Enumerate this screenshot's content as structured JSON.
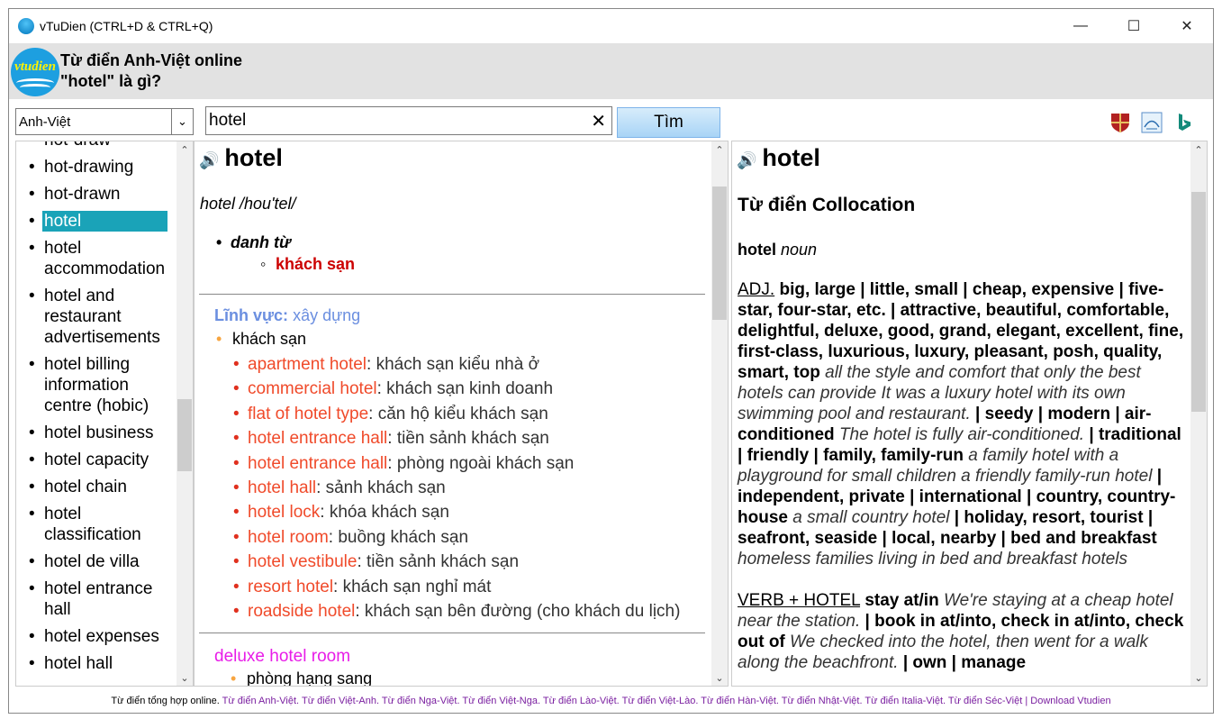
{
  "window": {
    "title": "vTuDien (CTRL+D & CTRL+Q)"
  },
  "header": {
    "logo_text": "vtudien",
    "line1": "Từ điển Anh-Việt online",
    "line2": "\"hotel\" là gì?"
  },
  "toolbar": {
    "lang": "Anh-Việt",
    "search_value": "hotel",
    "search_button": "Tìm"
  },
  "left_list": [
    "hot-draw",
    "hot-drawing",
    "hot-drawn",
    "hotel",
    "hotel accommodation",
    "hotel and restaurant advertisements",
    "hotel billing information centre (hobic)",
    "hotel business",
    "hotel capacity",
    "hotel chain",
    "hotel classification",
    "hotel de villa",
    "hotel entrance hall",
    "hotel expenses",
    "hotel hall"
  ],
  "mid": {
    "word": "hotel",
    "pron": "hotel /hou'tel/",
    "pos": "danh từ",
    "meaning": "khách sạn",
    "field_label": "Lĩnh vực:",
    "field_value": "xây dựng",
    "group": "khách sạn",
    "examples": [
      {
        "t": "apartment hotel",
        "m": ": khách sạn kiểu nhà ở"
      },
      {
        "t": "commercial hotel",
        "m": ": khách sạn kinh doanh"
      },
      {
        "t": "flat of hotel type",
        "m": ": căn hộ kiểu khách sạn"
      },
      {
        "t": "hotel entrance hall",
        "m": ": tiền sảnh khách sạn"
      },
      {
        "t": "hotel entrance hall",
        "m": ": phòng ngoài khách sạn"
      },
      {
        "t": "hotel hall",
        "m": ": sảnh khách sạn"
      },
      {
        "t": "hotel lock",
        "m": ": khóa khách sạn"
      },
      {
        "t": "hotel room",
        "m": ": buồng khách sạn"
      },
      {
        "t": "hotel vestibule",
        "m": ": tiền sảnh khách sạn"
      },
      {
        "t": "resort hotel",
        "m": ": khách sạn nghỉ mát"
      },
      {
        "t": "roadside hotel",
        "m": ": khách sạn bên đường (cho khách du lịch)"
      }
    ],
    "deluxe": "deluxe hotel room",
    "deluxe_meaning": "phòng hạng sang"
  },
  "right": {
    "word": "hotel",
    "coll": "Từ điển Collocation",
    "noun_word": "hotel",
    "noun": "noun",
    "adj_label": "ADJ.",
    "adj_bold1": "big, large | little, small | cheap, expensive | five-star, four-star, etc. | attractive, beautiful, comfortable, delightful, deluxe, good, grand, elegant, excellent, fine, first-class, luxurious, luxury, pleasant, posh, quality, smart, top",
    "adj_it1": "all the style and comfort that only the best hotels can provide It was a luxury hotel with its own swimming pool and restaurant.",
    "adj_bold2": "| seedy | modern | air-conditioned",
    "adj_it2": "The hotel is fully air-conditioned.",
    "adj_bold3": "| traditional | friendly | family, family-run",
    "adj_it3": "a family hotel with a playground for small children a friendly family-run hotel",
    "adj_bold4": "| independent, private | international | country, country-house",
    "adj_it4": "a small country hotel",
    "adj_bold5": "| holiday, resort, tourist | seafront, seaside | local, nearby | bed and breakfast",
    "adj_it5": "homeless families living in bed and breakfast hotels",
    "verb_label": "VERB + HOTEL",
    "verb_bold1": "stay at/in",
    "verb_it1": "We're staying at a cheap hotel near the station.",
    "verb_bold2": "| book in at/into, check in at/into, check out of",
    "verb_it2": "We checked into the hotel, then went for a walk along the beachfront.",
    "verb_bold3": "| own | manage"
  },
  "footer": {
    "lead": "Từ điển tổng hợp online.",
    "links": [
      "Từ điển Anh-Việt.",
      "Từ điển Việt-Anh.",
      "Từ điển Nga-Việt.",
      "Từ điển Việt-Nga.",
      "Từ điển Lào-Việt.",
      "Từ điển Việt-Lào.",
      "Từ điển Hàn-Việt.",
      "Từ điển Nhật-Việt.",
      "Từ điển Italia-Việt.",
      "Từ điển Séc-Việt",
      "| Download Vtudien"
    ]
  },
  "colors": {
    "selected": "#1aa3b8",
    "link": "#f04a2a",
    "field": "#6b8fe0",
    "meaning": "#cc0000",
    "deluxe": "#e81ce8"
  }
}
